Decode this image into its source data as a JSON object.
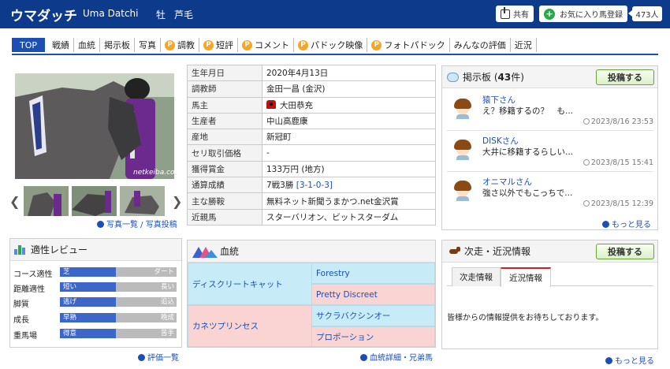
{
  "header": {
    "horse_name": "ウマダッチ",
    "horse_roman": "Uma Datchi",
    "sex": "牡",
    "coat": "芦毛",
    "share_label": "共有",
    "fav_label": "お気に入り馬登録",
    "fav_count": "473人",
    "bg_color": "#0e3a8c"
  },
  "nav": {
    "top": "TOP",
    "items": [
      "戦績",
      "血統",
      "掲示板",
      "写真"
    ],
    "p_items": [
      "調教",
      "短評",
      "コメント",
      "パドック映像",
      "フォトパドック"
    ],
    "tail_items": [
      "みんなの評価",
      "近況"
    ],
    "p_mark": "P"
  },
  "photo": {
    "watermark": "netkeiba.com",
    "link": "写真一覧 / 写真投稿"
  },
  "profile": {
    "rows": [
      {
        "k": "生年月日",
        "v": "2020年4月13日"
      },
      {
        "k": "調教師",
        "v": "金田一昌 (金沢)"
      },
      {
        "k": "馬主",
        "v": "大田恭充"
      },
      {
        "k": "生産者",
        "v": "中山高鹿康"
      },
      {
        "k": "産地",
        "v": "新冠町"
      },
      {
        "k": "セリ取引価格",
        "v": "-"
      },
      {
        "k": "獲得賞金",
        "v": "133万円 (地方)"
      },
      {
        "k": "通算成績",
        "v": "7戦3勝",
        "v2": "[3-1-0-3]"
      },
      {
        "k": "主な勝鞍",
        "v": "無料ネット新聞うまかつ.net金沢賞"
      },
      {
        "k": "近親馬",
        "v": "スターバリオン、ビットスターダム"
      }
    ]
  },
  "bbs": {
    "title": "掲示板 (",
    "count": "43",
    "title_tail": "件)",
    "post": "投稿する",
    "items": [
      {
        "name": "猿下さん",
        "text": "え？移籍するの？　も...",
        "time": "2023/8/16 23:53"
      },
      {
        "name": "DISKさん",
        "text": "大井に移籍するらしい...",
        "time": "2023/8/15 15:41"
      },
      {
        "name": "オニマルさん",
        "text": "強さ以外でもこっちで...",
        "time": "2023/8/15 12:39"
      }
    ],
    "more": "もっと見る"
  },
  "aptitude": {
    "title": "適性レビュー",
    "rows": [
      {
        "label": "コース適性",
        "left": "芝",
        "right": "ダート",
        "level": 0.48
      },
      {
        "label": "距離適性",
        "left": "短い",
        "right": "長い",
        "level": 0.48
      },
      {
        "label": "脚質",
        "left": "逃げ",
        "right": "追込",
        "level": 0.48
      },
      {
        "label": "成長",
        "left": "早熟",
        "right": "晩成",
        "level": 0.48
      },
      {
        "label": "重馬場",
        "left": "得意",
        "right": "苦手",
        "level": 0.48
      }
    ],
    "link": "評価一覧"
  },
  "pedigree": {
    "title": "血統",
    "sire": "ディスクリートキャット",
    "sire_sire": "Forestry",
    "sire_dam": "Pretty Discreet",
    "dam": "カネツプリンセス",
    "dam_sire": "サクラバクシンオー",
    "dam_dam": "プロポーション",
    "link": "血統詳細・兄弟馬"
  },
  "next": {
    "title": "次走・近況情報",
    "post": "投稿する",
    "tab1": "次走情報",
    "tab2": "近況情報",
    "body": "皆様からの情報提供をお待ちしております。",
    "more": "もっと見る"
  }
}
